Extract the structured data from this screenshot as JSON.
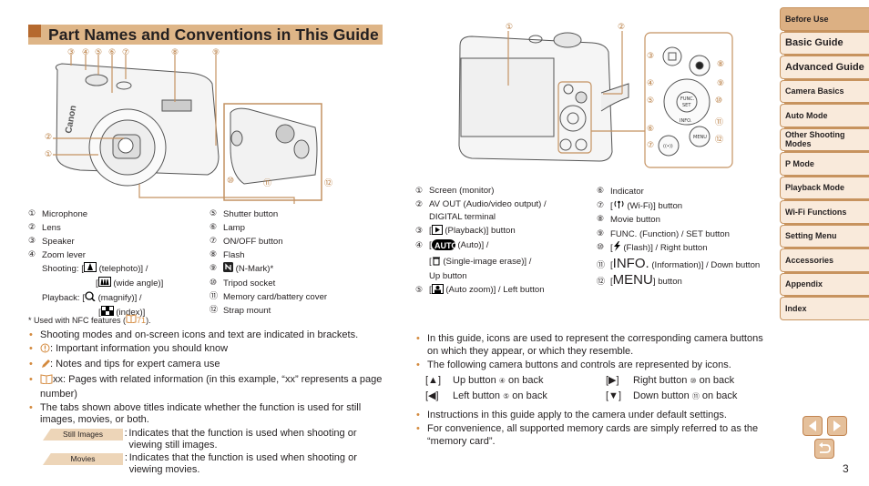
{
  "page": {
    "title": "Part Names and Conventions in This Guide",
    "number": "3",
    "accent_color": "#deb587",
    "accent_dark": "#b5692e"
  },
  "front_callouts": [
    "③",
    "④",
    "⑤",
    "⑥",
    "⑦",
    "⑧",
    "⑨",
    "②",
    "①",
    "⑩",
    "⑪",
    "⑫"
  ],
  "front_parts": [
    {
      "num": "①",
      "label": "Microphone"
    },
    {
      "num": "②",
      "label": "Lens"
    },
    {
      "num": "③",
      "label": "Speaker"
    },
    {
      "num": "④",
      "label": "Zoom lever"
    }
  ],
  "zoom_lever": {
    "shooting_label": "Shooting:",
    "telephoto": "(telephoto)] /",
    "wide": "(wide angle)]",
    "playback_label": "Playback:",
    "magnify": "(magnify)] /",
    "index": "(index)]"
  },
  "front_parts_right": [
    {
      "num": "⑤",
      "label": "Shutter button"
    },
    {
      "num": "⑥",
      "label": "Lamp"
    },
    {
      "num": "⑦",
      "label": "ON/OFF button"
    },
    {
      "num": "⑧",
      "label": "Flash"
    },
    {
      "num": "⑨",
      "label": "(N-Mark)*"
    },
    {
      "num": "⑩",
      "label": "Tripod socket"
    },
    {
      "num": "⑪",
      "label": "Memory card/battery cover"
    },
    {
      "num": "⑫",
      "label": "Strap mount"
    }
  ],
  "footnote": {
    "text": "* Used with NFC features (",
    "page": "71",
    "end": ")."
  },
  "back_parts_left": [
    {
      "num": "①",
      "label": "Screen (monitor)"
    },
    {
      "num": "②",
      "label": "AV OUT (Audio/video output) /",
      "label2": "DIGITAL terminal"
    },
    {
      "num": "③",
      "label": "(Playback)] button"
    },
    {
      "num": "④",
      "label": "(Auto)] /",
      "label2": "(Single-image erase)] /",
      "label3": "Up button"
    },
    {
      "num": "⑤",
      "label": "(Auto zoom)] / Left button"
    }
  ],
  "back_parts_right": [
    {
      "num": "⑥",
      "label": "Indicator"
    },
    {
      "num": "⑦",
      "label": "(Wi-Fi)] button"
    },
    {
      "num": "⑧",
      "label": "Movie button"
    },
    {
      "num": "⑨",
      "label": "FUNC. (Function) / SET button"
    },
    {
      "num": "⑩",
      "label": "(Flash)] / Right button"
    },
    {
      "num": "⑪",
      "label": "INFO.",
      "label2": "(Information)] / Down button"
    },
    {
      "num": "⑫",
      "label": "MENU",
      "label2": "button"
    }
  ],
  "left_bullets": [
    "Shooting modes and on-screen icons and text are indicated in brackets.",
    ": Important information you should know",
    ": Notes and tips for expert camera use",
    "xx: Pages with related information (in this example, “xx” represents a page number)",
    "The tabs shown above titles indicate whether the function is used for still images, movies, or both."
  ],
  "tabs": [
    {
      "label": "Still Images",
      "desc": "Indicates that the function is used when shooting or viewing still images."
    },
    {
      "label": "Movies",
      "desc": "Indicates that the function is used when shooting or viewing movies."
    }
  ],
  "right_bullets": [
    "In this guide, icons are used to represent the corresponding camera buttons on which they appear, or which they resemble.",
    "The following camera buttons and controls are represented by icons."
  ],
  "icon_buttons": [
    {
      "icon": "[▲]",
      "label": "Up button",
      "num": "④",
      "suffix": "on back"
    },
    {
      "icon": "[▶]",
      "label": "Right button",
      "num": "⑩",
      "suffix": "on back"
    },
    {
      "icon": "[◀]",
      "label": "Left button",
      "num": "⑤",
      "suffix": "on back"
    },
    {
      "icon": "[▼]",
      "label": "Down button",
      "num": "⑪",
      "suffix": "on back"
    }
  ],
  "right_bullets_2": [
    "Instructions in this guide apply to the camera under default settings.",
    "For convenience, all supported memory cards are simply referred to as the “memory card”."
  ],
  "sidebar": {
    "items": [
      {
        "label": "Before Use",
        "active": true
      },
      {
        "label": "Basic Guide",
        "big": true
      },
      {
        "label": "Advanced Guide",
        "big": true
      },
      {
        "label": "Camera Basics"
      },
      {
        "label": "Auto Mode"
      },
      {
        "label": "Other Shooting Modes"
      },
      {
        "label": "P Mode"
      },
      {
        "label": "Playback Mode"
      },
      {
        "label": "Wi-Fi Functions"
      },
      {
        "label": "Setting Menu"
      },
      {
        "label": "Accessories"
      },
      {
        "label": "Appendix"
      },
      {
        "label": "Index"
      }
    ]
  },
  "nav": {
    "prev": "previous-page",
    "next": "next-page",
    "back": "return"
  }
}
